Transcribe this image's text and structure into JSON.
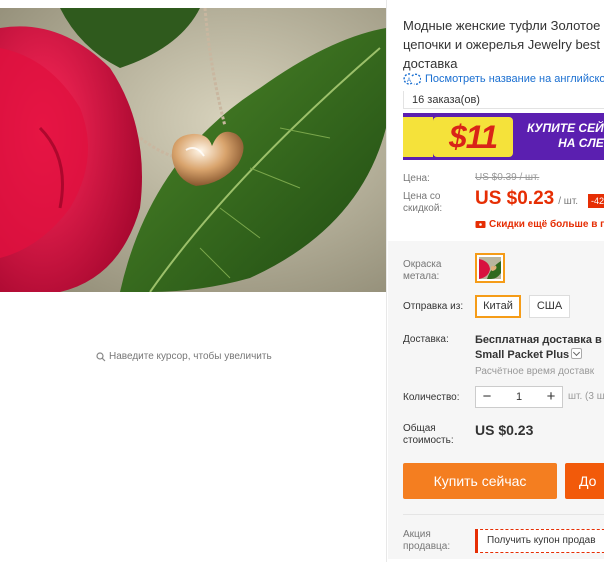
{
  "product": {
    "title_line1": "Модные женские туфли Золотое с",
    "title_line2": "цепочки и ожерелья Jewelry best",
    "title_line3": "доставка",
    "translate_link": "Посмотреть название на английско",
    "orders": "16 заказа(ов)"
  },
  "image": {
    "zoom_hint": "Наведите курсор, чтобы увеличить"
  },
  "banner": {
    "amount": "$11",
    "promo_line1": "КУПИТЕ СЕЙ",
    "promo_line2": "НА СЛЕ",
    "colors": {
      "background": "#5b1fb0",
      "amount_bg": "#f5e23a",
      "amount_text": "#d92418"
    }
  },
  "pricing": {
    "price_label": "Цена:",
    "old_price": "US $0.39 / шт.",
    "discount_label_line1": "Цена со",
    "discount_label_line2": "скидкой:",
    "new_price": "US $0.23",
    "unit": "/ шт.",
    "discount_badge": "-42",
    "coupon_text": "Скидки ещё больше в п",
    "accent_color": "#e62e04"
  },
  "sku": {
    "color_label_line1": "Окраска",
    "color_label_line2": "метала:",
    "ship_from_label": "Отправка из:",
    "ship_options": [
      {
        "label": "Китай",
        "selected": true
      },
      {
        "label": "США",
        "selected": false
      }
    ],
    "selection_color": "#f59c18"
  },
  "delivery": {
    "label": "Доставка:",
    "main_line1": "Бесплатная доставка в R",
    "main_line2": "Small Packet Plus",
    "sub": "Расчётное время доставк"
  },
  "quantity": {
    "label": "Количество:",
    "minus": "−",
    "value": "1",
    "plus": "+",
    "note": "шт. (3 ш"
  },
  "total": {
    "label_line1": "Общая",
    "label_line2": "стоимость:",
    "value": "US $0.23"
  },
  "actions": {
    "buy_now": "Купить сейчас",
    "add_to_cart": "До"
  },
  "seller": {
    "label_line1": "Акция",
    "label_line2": "продавца:",
    "coupon": "Получить купон продав"
  }
}
